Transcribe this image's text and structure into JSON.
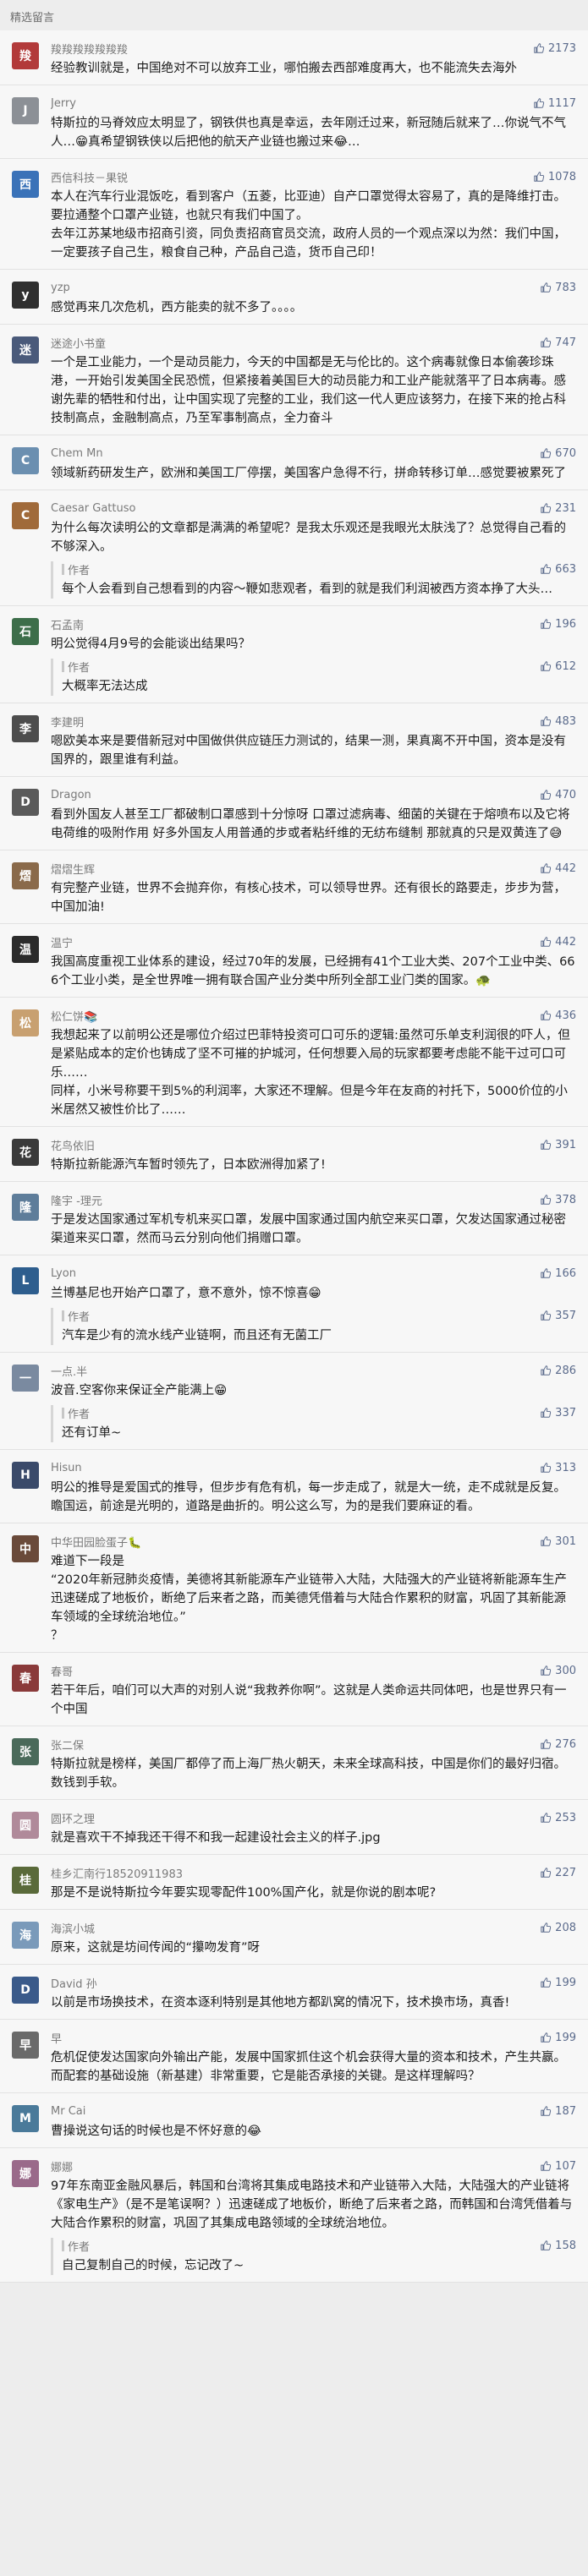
{
  "section_title": "精选留言",
  "colors": {
    "like_color": "#5b6b8c"
  },
  "comments": [
    {
      "nick": "羧羧羧羧羧羧羧",
      "likes": "2173",
      "avatar_color": "#b23a3a",
      "avatar_glyph": "羧",
      "text": "经验教训就是，中国绝对不可以放弃工业，哪怕搬去西部难度再大，也不能流失去海外"
    },
    {
      "nick": "Jerry",
      "likes": "1117",
      "avatar_color": "#8c9096",
      "avatar_glyph": "J",
      "text": "特斯拉的马脊效应太明显了，钢铁供也真是幸运，去年刚迁过来，新冠随后就来了…你说气不气人…😁真希望钢铁侠以后把他的航天产业链也搬过来😂…"
    },
    {
      "nick": "西信科技－果锐",
      "likes": "1078",
      "avatar_color": "#3a72b8",
      "avatar_glyph": "西",
      "text": "本人在汽车行业混饭吃，看到客户（五菱，比亚迪）自产口罩觉得太容易了，真的是降维打击。\n要拉通整个口罩产业链，也就只有我们中国了。\n去年江苏某地级市招商引资，同负责招商官员交流，政府人员的一个观点深以为然：我们中国，一定要孩子自己生，粮食自己种，产品自己造，货币自己印！"
    },
    {
      "nick": "yzp",
      "likes": "783",
      "avatar_color": "#2f2f2f",
      "avatar_glyph": "y",
      "text": "感觉再来几次危机，西方能卖的就不多了。。。。"
    },
    {
      "nick": "迷途小书童",
      "likes": "747",
      "avatar_color": "#4a5a7a",
      "avatar_glyph": "迷",
      "text": "一个是工业能力，一个是动员能力，今天的中国都是无与伦比的。这个病毒就像日本偷袭珍珠港，一开始引发美国全民恐慌，但紧接着美国巨大的动员能力和工业产能就落平了日本病毒。感谢先辈的牺牲和付出，让中国实现了完整的工业，我们这一代人更应该努力，在接下来的抢占科技制高点，金融制高点，乃至军事制高点，全力奋斗"
    },
    {
      "nick": "Chem Mn",
      "likes": "670",
      "avatar_color": "#6b8fb0",
      "avatar_glyph": "C",
      "text": "领域新药研发生产，欧洲和美国工厂停摆，美国客户急得不行，拼命转移订单…感觉要被累死了"
    },
    {
      "nick": "Caesar Gattuso",
      "likes": "231",
      "avatar_color": "#a06a3a",
      "avatar_glyph": "C",
      "text": "为什么每次读明公的文章都是满满的希望呢？是我太乐观还是我眼光太肤浅了？总觉得自己看的不够深入。",
      "reply": {
        "author": "作者",
        "likes": "663",
        "text": "每个人会看到自己想看到的内容～鞭如悲观者，看到的就是我们利润被西方资本挣了大头…"
      }
    },
    {
      "nick": "石孟南",
      "likes": "196",
      "avatar_color": "#3d6e4a",
      "avatar_glyph": "石",
      "text": "明公觉得4月9号的会能谈出结果吗？",
      "reply": {
        "author": "作者",
        "likes": "612",
        "text": "大概率无法达成"
      }
    },
    {
      "nick": "李建明",
      "likes": "483",
      "avatar_color": "#4d4d4d",
      "avatar_glyph": "李",
      "text": "嗯欧美本来是要借新冠对中国做供供应链压力测试的，结果一测，果真离不开中国，资本是没有国界的，跟里谁有利益。"
    },
    {
      "nick": "Dragon",
      "likes": "470",
      "avatar_color": "#5a5a5a",
      "avatar_glyph": "D",
      "text": "看到外国友人甚至工厂都破制口罩感到十分惊呀 口罩过滤病毒、细菌的关键在于熔喷布以及它将电荷维的吸附作用 好多外国友人用普通的步或者粘纤维的无纺布缝制 那就真的只是双黄连了😅"
    },
    {
      "nick": "熠熠生辉",
      "likes": "442",
      "avatar_color": "#8a6a4a",
      "avatar_glyph": "熠",
      "text": "有完整产业链，世界不会抛弃你，有核心技术，可以领导世界。还有很长的路要走，步步为营，中国加油!"
    },
    {
      "nick": "温宁",
      "likes": "442",
      "avatar_color": "#2b2b2b",
      "avatar_glyph": "温",
      "text": "我国高度重视工业体系的建设，经过70年的发展，已经拥有41个工业大类、207个工业中类、666个工业小类，是全世界唯一拥有联合国产业分类中所列全部工业门类的国家。🐢"
    },
    {
      "nick": "松仁饼📚",
      "likes": "436",
      "avatar_color": "#c8a070",
      "avatar_glyph": "松",
      "text": "我想起来了以前明公还是哪位介绍过巴菲特投资可口可乐的逻辑:虽然可乐单支利润很的吓人，但是紧贴成本的定价也铸成了坚不可摧的护城河，任何想要入局的玩家都要考虑能不能干过可口可乐……\n同样，小米号称要干到5%的利润率，大家还不理解。但是今年在友商的衬托下，5000价位的小米居然又被性价比了……"
    },
    {
      "nick": "花鸟依旧",
      "likes": "391",
      "avatar_color": "#3a3a3a",
      "avatar_glyph": "花",
      "text": "特斯拉新能源汽车暂时领先了，日本欧洲得加紧了!"
    },
    {
      "nick": "隆宇 -理元",
      "likes": "378",
      "avatar_color": "#5e7d9a",
      "avatar_glyph": "隆",
      "text": "于是发达国家通过军机专机来买口罩，发展中国家通过国内航空来买口罩，欠发达国家通过秘密渠道来买口罩，然而马云分别向他们捐赠口罩。"
    },
    {
      "nick": "Lyon",
      "likes": "166",
      "avatar_color": "#2e5e8e",
      "avatar_glyph": "L",
      "text": "兰博基尼也开始产口罩了，意不意外，惊不惊喜😁",
      "reply": {
        "author": "作者",
        "likes": "357",
        "text": "汽车是少有的流水线产业链啊，而且还有无菌工厂"
      }
    },
    {
      "nick": "一点.半",
      "likes": "286",
      "avatar_color": "#7a8aa0",
      "avatar_glyph": "一",
      "text": "波音.空客你来保证全产能满上😁",
      "reply": {
        "author": "作者",
        "likes": "337",
        "text": "还有订单~"
      }
    },
    {
      "nick": "Hisun",
      "likes": "313",
      "avatar_color": "#3a4a6a",
      "avatar_glyph": "H",
      "text": "明公的推导是爱国式的推导，但步步有危有机，每一步走成了，就是大一统，走不成就是反复。瞻国运，前途是光明的，道路是曲折的。明公这么写，为的是我们要麻证的看。"
    },
    {
      "nick": "中华田园脸蛋子🐛",
      "likes": "301",
      "avatar_color": "#6a4a3a",
      "avatar_glyph": "中",
      "text": "难道下一段是\n“2020年新冠肺炎疫情，美德将其新能源车产业链带入大陆，大陆强大的产业链将新能源车生产迅速磋成了地板价，断绝了后来者之路，而美德凭借着与大陆合作累积的财富，巩固了其新能源车领域的全球统治地位。”\n？"
    },
    {
      "nick": "春哥",
      "likes": "300",
      "avatar_color": "#8a3a3a",
      "avatar_glyph": "春",
      "text": "若干年后，咱们可以大声的对别人说“我救养你啊”。这就是人类命运共同体吧，也是世界只有一个中国"
    },
    {
      "nick": "张二保",
      "likes": "276",
      "avatar_color": "#4a6a5a",
      "avatar_glyph": "张",
      "text": "特斯拉就是榜样，美国厂都停了而上海厂热火朝天，未来全球高科技，中国是你们的最好归宿。数钱到手软。"
    },
    {
      "nick": "圆环之理",
      "likes": "253",
      "avatar_color": "#b08a9a",
      "avatar_glyph": "圆",
      "text": "就是喜欢干不掉我还干得不和我一起建设社会主义的样子.jpg"
    },
    {
      "nick": "桂乡汇南行18520911983",
      "likes": "227",
      "avatar_color": "#5a6a3a",
      "avatar_glyph": "桂",
      "text": "那是不是说特斯拉今年要实现零配件100%国产化，就是你说的剧本呢?"
    },
    {
      "nick": "海滨小城",
      "likes": "208",
      "avatar_color": "#7a9aba",
      "avatar_glyph": "海",
      "text": "原来，这就是坊间传闻的“攥吻发育”呀"
    },
    {
      "nick": "David 孙",
      "likes": "199",
      "avatar_color": "#3a5a8a",
      "avatar_glyph": "D",
      "text": "以前是市场换技术，在资本逐利特别是其他地方都趴窝的情况下，技术换市场，真香!"
    },
    {
      "nick": "早",
      "likes": "199",
      "avatar_color": "#6a6a6a",
      "avatar_glyph": "早",
      "text": "危机促使发达国家向外输出产能，发展中国家抓住这个机会获得大量的资本和技术，产生共赢。而配套的基础设施（新基建）非常重要，它是能否承接的关键。是这样理解吗？"
    },
    {
      "nick": "Mr Cai",
      "likes": "187",
      "avatar_color": "#4a7a9a",
      "avatar_glyph": "M",
      "text": "曹操说这句话的时候也是不怀好意的😂"
    },
    {
      "nick": "娜娜",
      "likes": "107",
      "avatar_color": "#9a6a8a",
      "avatar_glyph": "娜",
      "text": "97年东南亚金融风暴后，韩国和台湾将其集成电路技术和产业链带入大陆，大陆强大的产业链将《家电生产》（是不是笔误啊？）迅速磋成了地板价，断绝了后来者之路，而韩国和台湾凭借着与大陆合作累积的财富，巩固了其集成电路领域的全球统治地位。",
      "reply": {
        "author": "作者",
        "likes": "158",
        "text": "自己复制自己的时候，忘记改了~"
      }
    }
  ]
}
